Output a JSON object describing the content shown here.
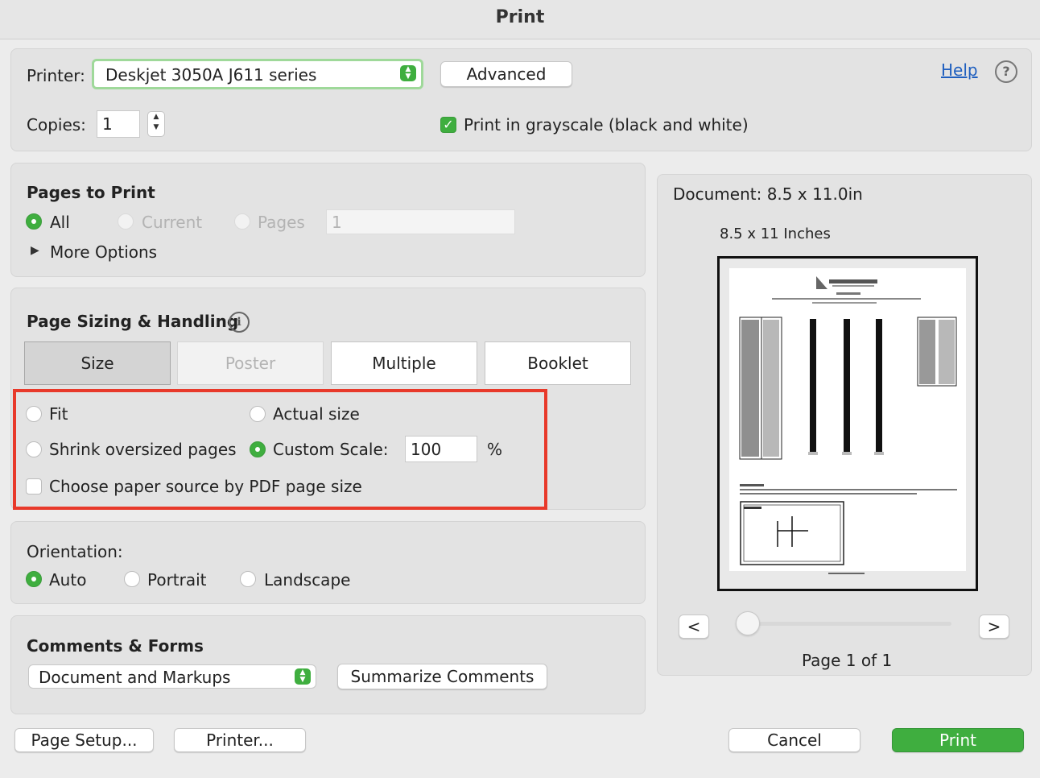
{
  "window": {
    "title": "Print"
  },
  "printer": {
    "label": "Printer:",
    "selected": "Deskjet 3050A J611 series",
    "advanced_label": "Advanced",
    "help_label": "Help",
    "copies_label": "Copies:",
    "copies_value": "1",
    "grayscale_label": "Print in grayscale (black and white)",
    "grayscale_checked": true
  },
  "pages": {
    "title": "Pages to Print",
    "all_label": "All",
    "current_label": "Current",
    "pages_label": "Pages",
    "pages_value": "1",
    "more_options_label": "More Options"
  },
  "sizing": {
    "title": "Page Sizing & Handling",
    "tabs": [
      "Size",
      "Poster",
      "Multiple",
      "Booklet"
    ],
    "fit_label": "Fit",
    "actual_size_label": "Actual size",
    "shrink_label": "Shrink oversized pages",
    "custom_scale_label": "Custom Scale:",
    "custom_scale_value": "100",
    "percent_label": "%",
    "paper_source_label": "Choose paper source by PDF page size",
    "highlight_color": "#e8392a"
  },
  "orientation": {
    "title": "Orientation:",
    "auto_label": "Auto",
    "portrait_label": "Portrait",
    "landscape_label": "Landscape"
  },
  "comments": {
    "title": "Comments & Forms",
    "selected": "Document and Markups",
    "summarize_label": "Summarize Comments"
  },
  "preview": {
    "document_size": "Document: 8.5 x 11.0in",
    "paper_label": "8.5 x 11 Inches",
    "prev_label": "<",
    "next_label": ">",
    "page_indicator": "Page 1 of 1"
  },
  "footer": {
    "page_setup_label": "Page Setup...",
    "printer_label": "Printer...",
    "cancel_label": "Cancel",
    "print_label": "Print"
  },
  "colors": {
    "accent": "#3fae3f",
    "link": "#1f5fbf"
  }
}
